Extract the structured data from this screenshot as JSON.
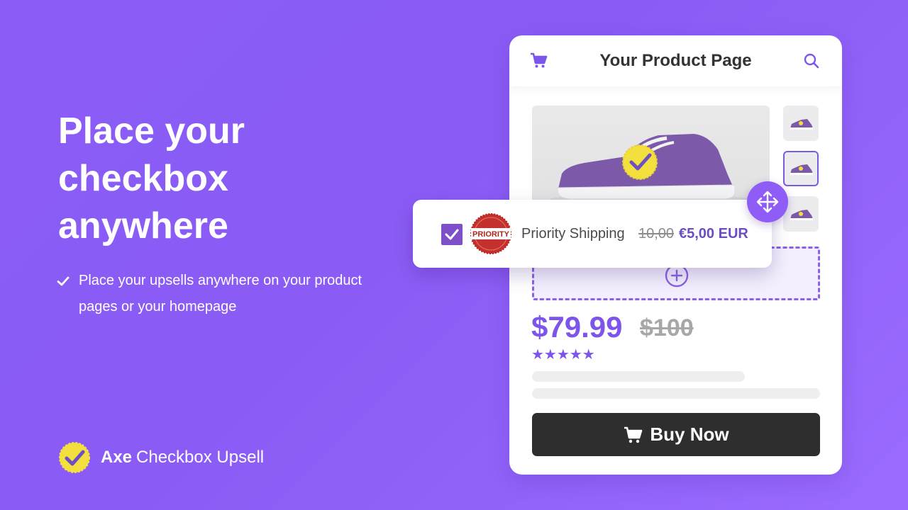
{
  "hero": {
    "headline_lines": [
      "Place your",
      "checkbox",
      "anywhere"
    ],
    "bullet": "Place your upsells anywhere on your product pages or your homepage"
  },
  "brand": {
    "name_strong": "Axe",
    "name_rest": "Checkbox Upsell"
  },
  "product_card": {
    "title": "Your Product Page",
    "price": "$79.99",
    "old_price": "$100",
    "rating": "★★★★★",
    "buy_label": "Buy Now"
  },
  "upsell": {
    "checked": true,
    "badge_text": "PRIORITY",
    "label": "Priority Shipping",
    "old_price": "10,00",
    "new_price": "€5,00 EUR"
  },
  "colors": {
    "accent": "#8b5cf6",
    "price": "#7d55ea",
    "button": "#2e2e2e"
  },
  "icons": [
    "cart-icon",
    "search-icon",
    "plus-circle-icon",
    "move-icon",
    "check-icon",
    "checkmark-badge-icon"
  ]
}
